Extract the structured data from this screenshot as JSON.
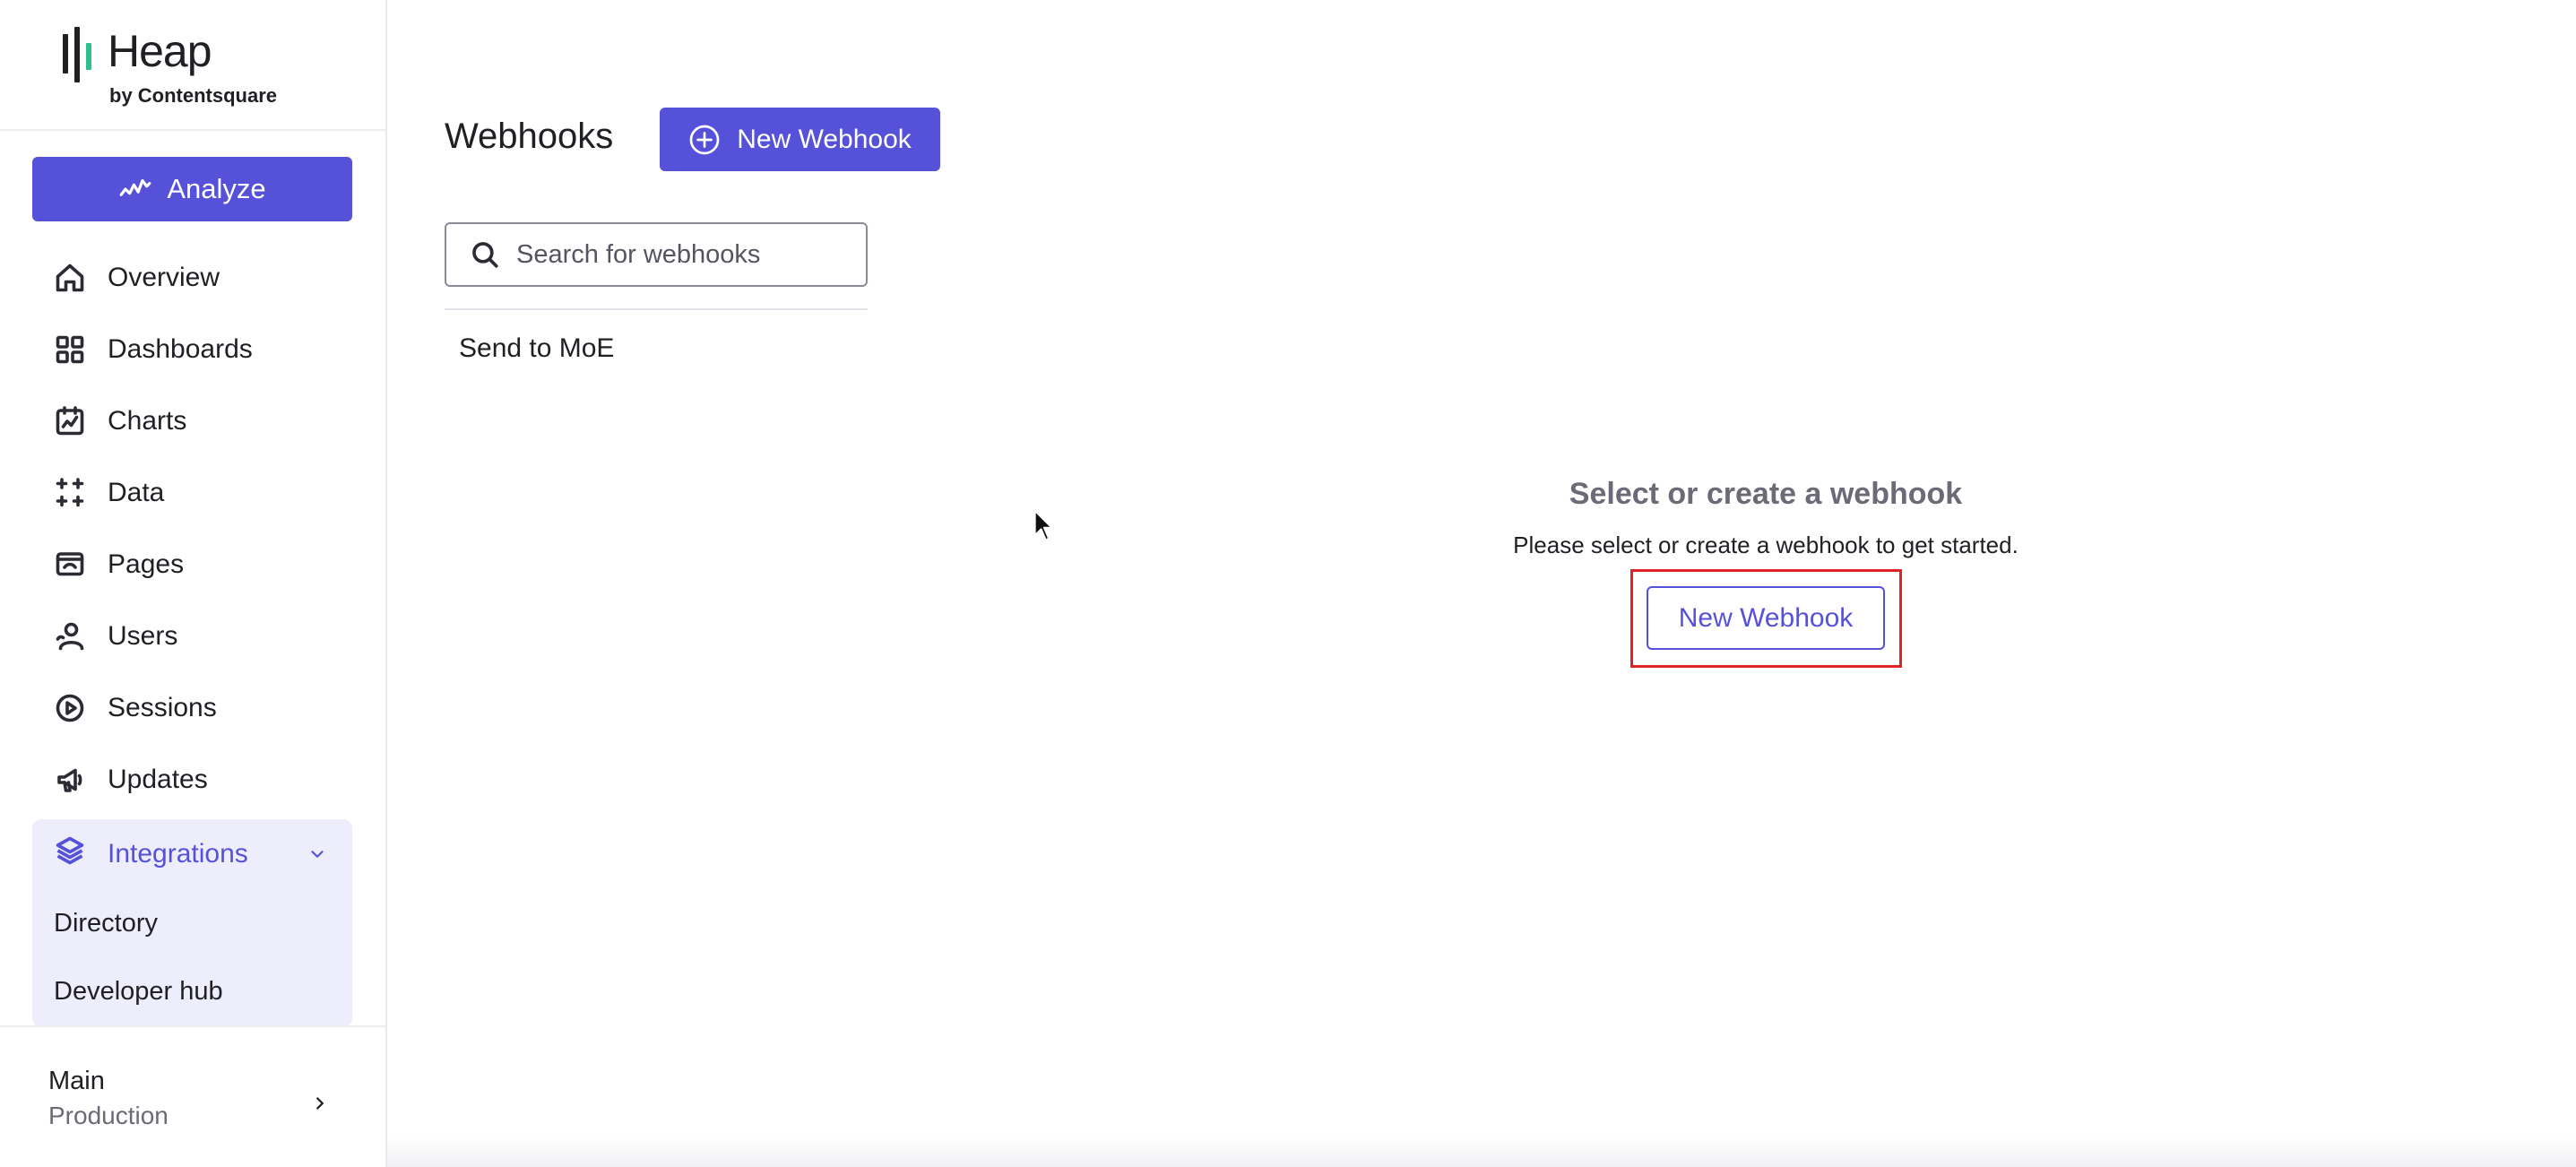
{
  "brand": {
    "name": "Heap",
    "subtitle": "by Contentsquare",
    "accent_color": "#2fbf8a"
  },
  "sidebar": {
    "analyze_label": "Analyze",
    "items": [
      {
        "label": "Overview",
        "icon": "home-icon"
      },
      {
        "label": "Dashboards",
        "icon": "grid-icon"
      },
      {
        "label": "Charts",
        "icon": "chart-icon"
      },
      {
        "label": "Data",
        "icon": "sparkles-icon"
      },
      {
        "label": "Pages",
        "icon": "pages-icon"
      },
      {
        "label": "Users",
        "icon": "users-icon"
      },
      {
        "label": "Sessions",
        "icon": "play-circle-icon"
      },
      {
        "label": "Updates",
        "icon": "megaphone-icon"
      }
    ],
    "integrations": {
      "label": "Integrations",
      "icon": "layers-icon",
      "expanded": true,
      "sub_items": [
        "Directory",
        "Developer hub"
      ]
    },
    "environment": {
      "name": "Main",
      "sub": "Production"
    }
  },
  "main": {
    "title": "Webhooks",
    "new_webhook_label": "New Webhook",
    "search": {
      "placeholder": "Search for webhooks",
      "value": ""
    },
    "webhooks": [
      "Send to MoE"
    ],
    "empty_state": {
      "title": "Select or create a webhook",
      "description": "Please select or create a webhook to get started.",
      "button_label": "New Webhook"
    }
  },
  "colors": {
    "primary": "#5651d9",
    "highlight": "#e02424",
    "active_bg": "#ededfb"
  }
}
